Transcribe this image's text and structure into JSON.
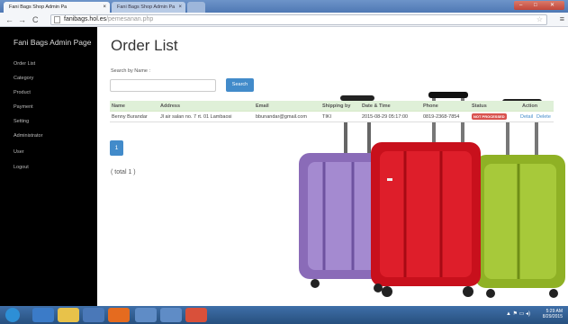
{
  "browser": {
    "tabs": [
      {
        "label": "Fani Bags Shop Admin Pa",
        "active": true
      },
      {
        "label": "Fani Bags Shop Admin Pa",
        "active": false
      }
    ],
    "url_host": "fanibags.hol.es",
    "url_path": "/pemesanan.php",
    "nav_icons": [
      "back-icon",
      "forward-icon",
      "reload-icon"
    ]
  },
  "sidebar": {
    "brand": "Fani Bags Admin Page",
    "items": [
      "Order List",
      "Category",
      "Product",
      "Payment",
      "Setting",
      "Administrator",
      "User",
      "Logout"
    ]
  },
  "main": {
    "title": "Order List",
    "search_label": "Search by Name :",
    "search_value": "",
    "search_button": "Search",
    "table": {
      "headers": [
        "Name",
        "Address",
        "Email",
        "Shipping by",
        "Date & Time",
        "Phone",
        "Status",
        "Action"
      ],
      "rows": [
        {
          "name": "Benny Burandar",
          "address": "Jl air salan no. 7 rt. 01 Lambaosi",
          "email": "bbunandar@gmail.com",
          "shipping": "TIKI",
          "datetime": "2015-08-29 05:17:00",
          "phone": "0819-2368-7854",
          "status": "NOT PROCESSED",
          "action_detail": "Detail",
          "action_delete": "Delete"
        }
      ]
    },
    "pagination": [
      "1"
    ],
    "total": "( total 1 )"
  },
  "taskbar": {
    "time": "5:29 AM",
    "date": "8/29/2015"
  },
  "colors": {
    "sidebar_bg": "#000000",
    "primary": "#428bca",
    "table_header": "#dff0d8",
    "status_badge": "#d9534f"
  }
}
